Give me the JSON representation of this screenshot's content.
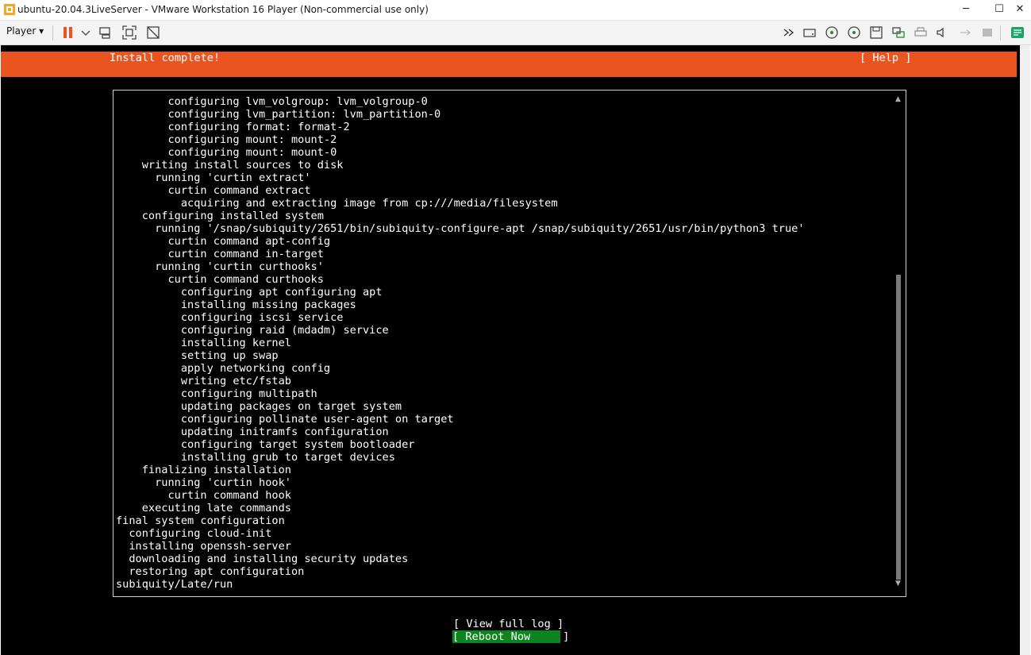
{
  "window": {
    "title": "ubuntu-20.04.3LiveServer - VMware Workstation 16 Player (Non-commercial use only)",
    "minimize_glyph": "─",
    "maximize_glyph": "☐",
    "close_glyph": "✕"
  },
  "toolbar": {
    "player_menu_label": "Player ▾"
  },
  "installer": {
    "title": "Install complete!",
    "help_label": "[ Help ]",
    "accent_color": "#e95420",
    "log_lines": [
      "        configuring lvm_volgroup: lvm_volgroup-0",
      "        configuring lvm_partition: lvm_partition-0",
      "        configuring format: format-2",
      "        configuring mount: mount-2",
      "        configuring mount: mount-0",
      "    writing install sources to disk",
      "      running 'curtin extract'",
      "        curtin command extract",
      "          acquiring and extracting image from cp:///media/filesystem",
      "    configuring installed system",
      "      running '/snap/subiquity/2651/bin/subiquity-configure-apt /snap/subiquity/2651/usr/bin/python3 true'",
      "        curtin command apt-config",
      "        curtin command in-target",
      "      running 'curtin curthooks'",
      "        curtin command curthooks",
      "          configuring apt configuring apt",
      "          installing missing packages",
      "          configuring iscsi service",
      "          configuring raid (mdadm) service",
      "          installing kernel",
      "          setting up swap",
      "          apply networking config",
      "          writing etc/fstab",
      "          configuring multipath",
      "          updating packages on target system",
      "          configuring pollinate user-agent on target",
      "          updating initramfs configuration",
      "          configuring target system bootloader",
      "          installing grub to target devices",
      "    finalizing installation",
      "      running 'curtin hook'",
      "        curtin command hook",
      "    executing late commands",
      "final system configuration",
      "  configuring cloud-init",
      "  installing openssh-server",
      "  downloading and installing security updates",
      "  restoring apt configuration",
      "subiquity/Late/run"
    ],
    "view_log_label": "[ View full log ]",
    "reboot_label": "[ Reboot Now     ]",
    "reboot_color": "#0e8420"
  }
}
